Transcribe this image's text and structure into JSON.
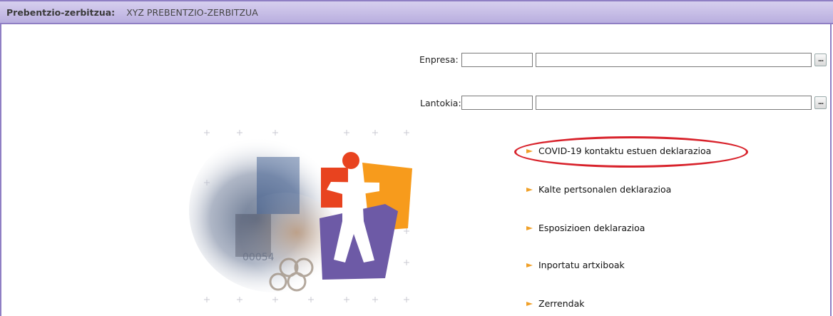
{
  "header": {
    "label": "Prebentzio-zerbitzua:",
    "value": "XYZ PREBENTZIO-ZERBITZUA"
  },
  "form": {
    "enpresa_label": "Enpresa:",
    "lantokia_label": "Lantokia:",
    "enpresa_code": "",
    "enpresa_name": "",
    "lantokia_code": "",
    "lantokia_name": "",
    "lookup_button": "..."
  },
  "menu": {
    "items": [
      {
        "label": "COVID-19 kontaktu estuen deklarazioa"
      },
      {
        "label": "Kalte pertsonalen deklarazioa"
      },
      {
        "label": "Esposizioen deklarazioa"
      },
      {
        "label": "Inportatu artxiboak"
      },
      {
        "label": "Zerrendak"
      }
    ]
  },
  "colors": {
    "header_bg": "#b9aedf",
    "border": "#8f7fc4",
    "arrow": "#f0a028",
    "highlight": "#d8222b",
    "logo_red": "#e8431f",
    "logo_orange": "#f79b1c",
    "logo_purple": "#6d5aa6"
  }
}
